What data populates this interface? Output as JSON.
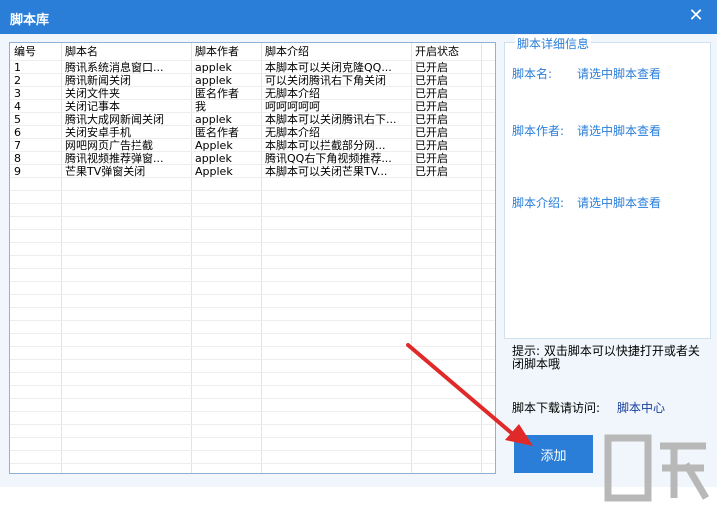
{
  "window": {
    "title": "脚本库",
    "close_glyph": "✕"
  },
  "list": {
    "columns": [
      "编号",
      "脚本名",
      "脚本作者",
      "脚本介绍",
      "开启状态"
    ],
    "rows": [
      {
        "num": "1",
        "name": "腾讯系统消息窗口...",
        "author": "applek",
        "intro": "本脚本可以关闭克隆QQ...",
        "status": "已开启"
      },
      {
        "num": "2",
        "name": "腾讯新闻关闭",
        "author": "applek",
        "intro": "可以关闭腾讯右下角关闭",
        "status": "已开启"
      },
      {
        "num": "3",
        "name": "关闭文件夹",
        "author": "匿名作者",
        "intro": "无脚本介绍",
        "status": "已开启"
      },
      {
        "num": "4",
        "name": "关闭记事本",
        "author": "我",
        "intro": "呵呵呵呵呵",
        "status": "已开启"
      },
      {
        "num": "5",
        "name": "腾讯大成网新闻关闭",
        "author": "applek",
        "intro": "本脚本可以关闭腾讯右下...",
        "status": "已开启"
      },
      {
        "num": "6",
        "name": "关闭安卓手机",
        "author": "匿名作者",
        "intro": "无脚本介绍",
        "status": "已开启"
      },
      {
        "num": "7",
        "name": "网吧网页广告拦截",
        "author": "Applek",
        "intro": "本脚本可以拦截部分网...",
        "status": "已开启"
      },
      {
        "num": "8",
        "name": "腾讯视频推荐弹窗...",
        "author": "applek",
        "intro": "腾讯QQ右下角视频推荐...",
        "status": "已开启"
      },
      {
        "num": "9",
        "name": "芒果TV弹窗关闭",
        "author": "Applek",
        "intro": "本脚本可以关闭芒果TV...",
        "status": "已开启"
      }
    ]
  },
  "detail": {
    "title": "脚本详细信息",
    "name_label": "脚本名:",
    "name_value": "请选中脚本查看",
    "author_label": "脚本作者:",
    "author_value": "请选中脚本查看",
    "intro_label": "脚本介绍:",
    "intro_value": "请选中脚本查看"
  },
  "tip": "提示: 双击脚本可以快捷打开或者关闭脚本哦",
  "download": {
    "label": "脚本下载请访问:",
    "link": "脚本中心"
  },
  "add_button": "添加",
  "colors": {
    "accent": "#2a7ed8",
    "link": "#1a3f9c",
    "background": "#f0f6fb",
    "arrow": "#e02a2a"
  }
}
